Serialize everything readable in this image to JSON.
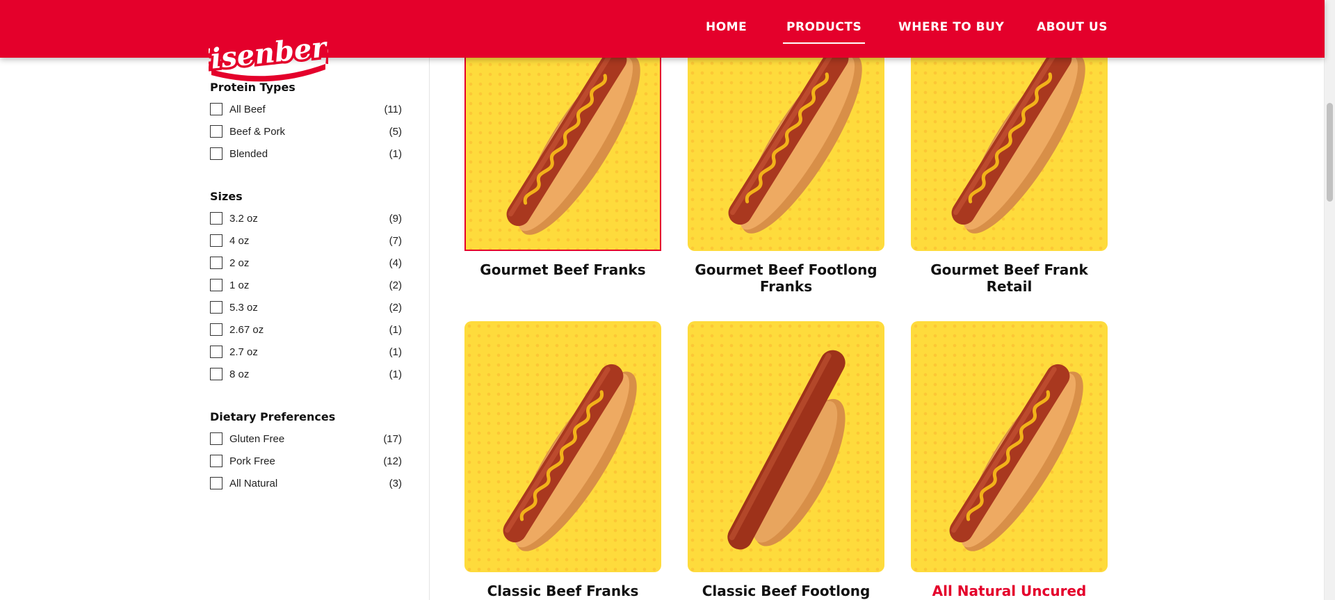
{
  "brand": {
    "name": "Eisenberg",
    "logo_color": "#e4002b"
  },
  "nav": {
    "items": [
      {
        "label": "HOME",
        "active": false
      },
      {
        "label": "PRODUCTS",
        "active": true
      },
      {
        "label": "WHERE TO BUY",
        "active": false
      },
      {
        "label": "ABOUT US",
        "active": false
      }
    ]
  },
  "filters": {
    "protein": {
      "title": "Protein Types",
      "options": [
        {
          "label": "All Beef",
          "count": "(11)"
        },
        {
          "label": "Beef & Pork",
          "count": "(5)"
        },
        {
          "label": "Blended",
          "count": "(1)"
        }
      ]
    },
    "sizes": {
      "title": "Sizes",
      "options": [
        {
          "label": "3.2 oz",
          "count": "(9)"
        },
        {
          "label": "4 oz",
          "count": "(7)"
        },
        {
          "label": "2 oz",
          "count": "(4)"
        },
        {
          "label": "1 oz",
          "count": "(2)"
        },
        {
          "label": "5.3 oz",
          "count": "(2)"
        },
        {
          "label": "2.67 oz",
          "count": "(1)"
        },
        {
          "label": "2.7 oz",
          "count": "(1)"
        },
        {
          "label": "8 oz",
          "count": "(1)"
        }
      ]
    },
    "dietary": {
      "title": "Dietary Preferences",
      "options": [
        {
          "label": "Gluten Free",
          "count": "(17)"
        },
        {
          "label": "Pork Free",
          "count": "(12)"
        },
        {
          "label": "All Natural",
          "count": "(3)"
        }
      ]
    }
  },
  "products": [
    {
      "name": "Gourmet Beef Franks",
      "mustard": true,
      "selected": true,
      "highlight": false
    },
    {
      "name": "Gourmet Beef Footlong Franks",
      "mustard": true,
      "selected": false,
      "highlight": false
    },
    {
      "name": "Gourmet Beef Frank Retail",
      "mustard": true,
      "selected": false,
      "highlight": false
    },
    {
      "name": "Classic Beef Franks",
      "mustard": true,
      "selected": false,
      "highlight": false
    },
    {
      "name": "Classic Beef Footlong",
      "mustard": false,
      "selected": false,
      "highlight": false
    },
    {
      "name": "All Natural Uncured",
      "mustard": true,
      "selected": false,
      "highlight": true
    }
  ],
  "colors": {
    "brand_red": "#e4002b",
    "card_yellow": "#fedb3c",
    "bun": "#e9a25a",
    "sausage": "#a9381f",
    "mustard": "#f2b21a"
  },
  "icons": {
    "checkbox": "checkbox-icon",
    "product_image": "hotdog-icon"
  }
}
